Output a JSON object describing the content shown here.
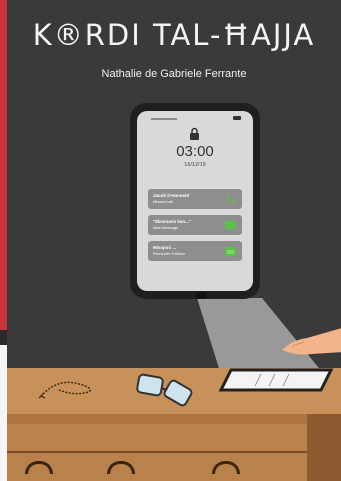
{
  "book": {
    "title": "K®RDI TAL-ĦAJJA",
    "author": "Nathalie de Gabriele Ferrante"
  },
  "phone": {
    "time": "03:00",
    "date": "16/12/19",
    "notifications": [
      {
        "title": "Jacob il-Hanneid",
        "detail": "Missed call",
        "icon": "phone-icon"
      },
      {
        "title": "\"Ilkomunis ken...\"",
        "detail": "New Message",
        "icon": "message-icon"
      },
      {
        "title": "Missjoni ...",
        "detail": "Reminder 9:00am",
        "icon": "calendar-icon"
      }
    ]
  },
  "colors": {
    "background": "#3a3a3a",
    "accent_red": "#c8333a",
    "desk": "#c9915a",
    "notification": "#8e8e8e",
    "icon_green": "#5cc247"
  }
}
